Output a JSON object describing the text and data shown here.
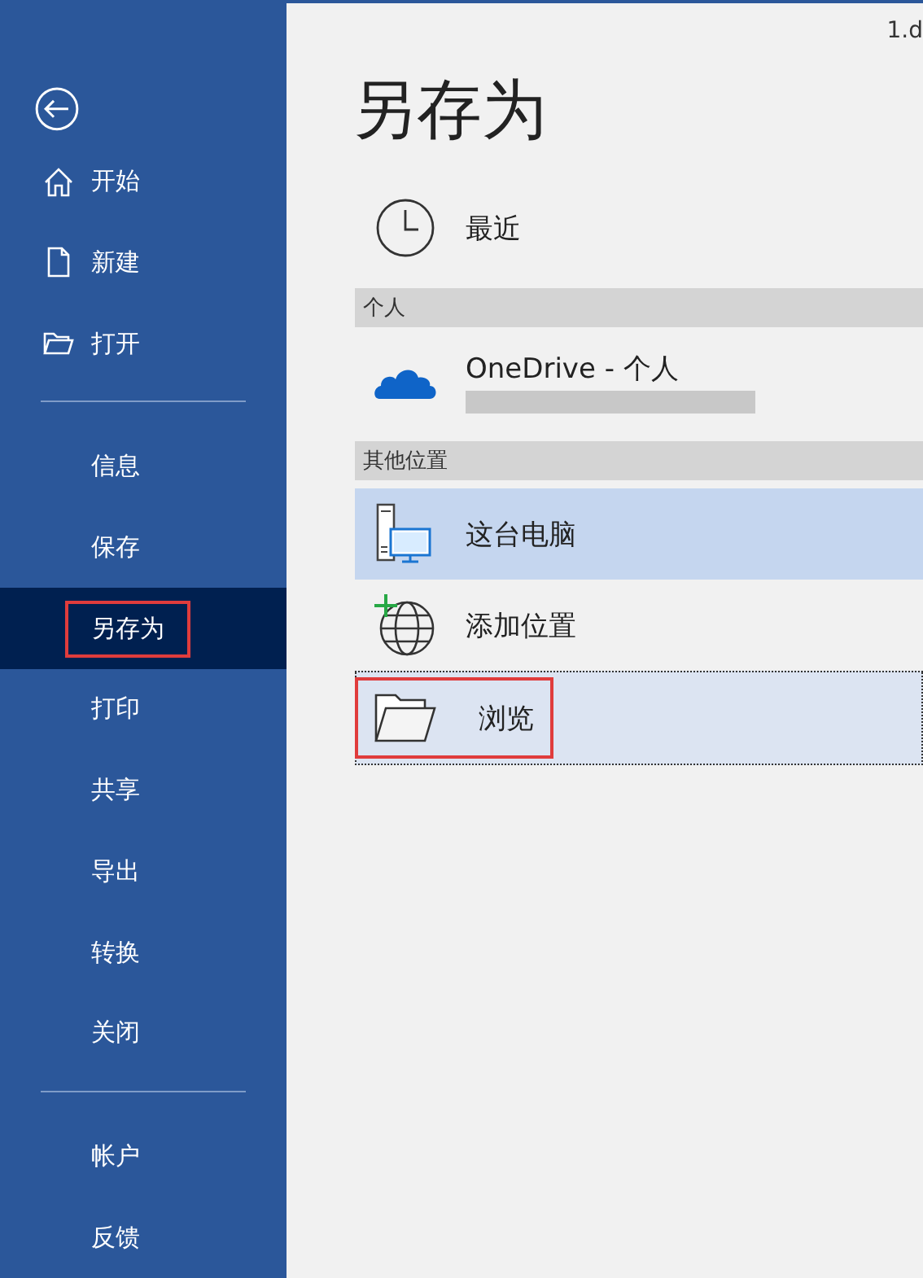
{
  "document_title": "1.d",
  "sidebar": {
    "items": [
      {
        "kind": "home",
        "label": "开始",
        "selected": false,
        "annotated": false
      },
      {
        "kind": "new",
        "label": "新建",
        "selected": false,
        "annotated": false
      },
      {
        "kind": "open",
        "label": "打开",
        "selected": false,
        "annotated": false
      },
      {
        "kind": "divider"
      },
      {
        "kind": "plain",
        "label": "信息",
        "selected": false,
        "annotated": false
      },
      {
        "kind": "plain",
        "label": "保存",
        "selected": false,
        "annotated": false
      },
      {
        "kind": "plain",
        "label": "另存为",
        "selected": true,
        "annotated": true
      },
      {
        "kind": "plain",
        "label": "打印",
        "selected": false,
        "annotated": false
      },
      {
        "kind": "plain",
        "label": "共享",
        "selected": false,
        "annotated": false
      },
      {
        "kind": "plain",
        "label": "导出",
        "selected": false,
        "annotated": false
      },
      {
        "kind": "plain",
        "label": "转换",
        "selected": false,
        "annotated": false
      },
      {
        "kind": "plain",
        "label": "关闭",
        "selected": false,
        "annotated": false
      },
      {
        "kind": "divider"
      },
      {
        "kind": "plain",
        "label": "帐户",
        "selected": false,
        "annotated": false
      },
      {
        "kind": "plain",
        "label": "反馈",
        "selected": false,
        "annotated": false
      }
    ]
  },
  "page_title": "另存为",
  "locations": [
    {
      "kind": "recent",
      "label": "最近",
      "selected": false,
      "focused": false,
      "annotated": false
    },
    {
      "kind": "header",
      "label": "个人"
    },
    {
      "kind": "onedrive",
      "label": "OneDrive - 个人",
      "redacted": true,
      "selected": false,
      "focused": false,
      "annotated": false
    },
    {
      "kind": "header",
      "label": "其他位置"
    },
    {
      "kind": "computer",
      "label": "这台电脑",
      "selected": true,
      "focused": false,
      "annotated": false
    },
    {
      "kind": "add-place",
      "label": "添加位置",
      "selected": false,
      "focused": false,
      "annotated": false
    },
    {
      "kind": "browse",
      "label": "浏览",
      "selected": false,
      "focused": true,
      "annotated": true
    }
  ]
}
